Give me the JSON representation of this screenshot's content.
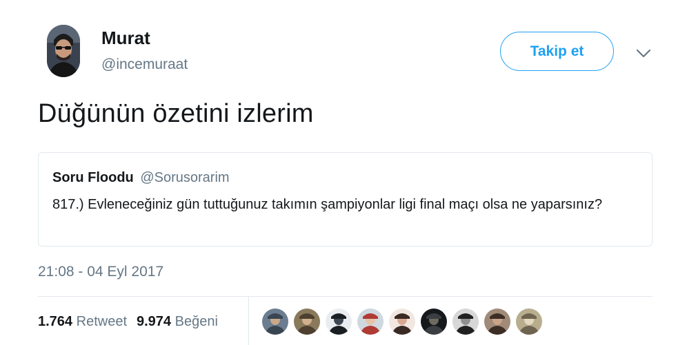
{
  "user": {
    "display_name": "Murat",
    "screen_name": "@incemuraat"
  },
  "follow_button": {
    "label": "Takip et"
  },
  "menu": {
    "icon": "chevron-down-icon"
  },
  "tweet": {
    "text": "Düğünün özetini izlerim"
  },
  "quoted_tweet": {
    "display_name": "Soru Floodu",
    "screen_name": "@Sorusorarim",
    "text": "817.) Evleneceğiniz gün tuttuğunuz takımın şampiyonlar ligi final maçı olsa ne yaparsınız?"
  },
  "timestamp": "21:08 - 04 Eyl 2017",
  "stats": {
    "retweets": {
      "count": "1.764",
      "label": "Retweet"
    },
    "likes": {
      "count": "9.974",
      "label": "Beğeni"
    }
  },
  "likers": [
    {
      "name": "liker-avatar-1",
      "colors": [
        "#6b7d8f",
        "#3a4552",
        "#c9a98a"
      ]
    },
    {
      "name": "liker-avatar-2",
      "colors": [
        "#8a7a5c",
        "#4d4030",
        "#d2b08e"
      ]
    },
    {
      "name": "liker-avatar-3",
      "colors": [
        "#e9edf0",
        "#1b1f24",
        "#3d4754"
      ]
    },
    {
      "name": "liker-avatar-4",
      "colors": [
        "#cfd8de",
        "#b03a34",
        "#e6c3a8"
      ]
    },
    {
      "name": "liker-avatar-5",
      "colors": [
        "#f2e6e1",
        "#3a2a24",
        "#d9a893"
      ]
    },
    {
      "name": "liker-avatar-6",
      "colors": [
        "#16191c",
        "#3b3f44",
        "#6f6a60"
      ]
    },
    {
      "name": "liker-avatar-7",
      "colors": [
        "#d7d7d7",
        "#202020",
        "#8f8f8f"
      ]
    },
    {
      "name": "liker-avatar-8",
      "colors": [
        "#a08a78",
        "#3c2e25",
        "#caa48a"
      ]
    },
    {
      "name": "liker-avatar-9",
      "colors": [
        "#b8ae8e",
        "#6e6450",
        "#e2d9c0"
      ]
    }
  ],
  "colors": {
    "accent": "#1da1f2",
    "text_primary": "#14171a",
    "text_secondary": "#657786",
    "border": "#e1e8ed"
  }
}
